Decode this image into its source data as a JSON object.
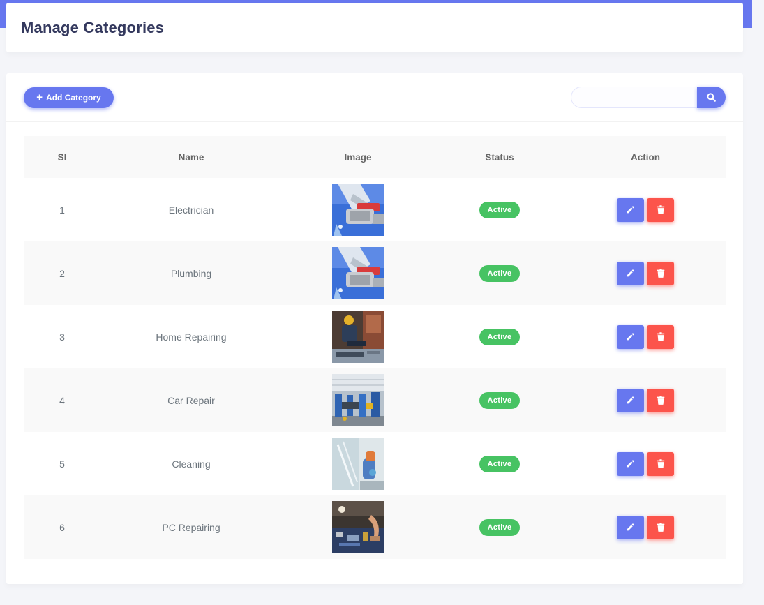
{
  "header": {
    "title": "Manage Categories"
  },
  "toolbar": {
    "add_label": "Add Category",
    "search_placeholder": ""
  },
  "table": {
    "columns": [
      "Sl",
      "Name",
      "Image",
      "Status",
      "Action"
    ],
    "rows": [
      {
        "sl": "1",
        "name": "Electrician",
        "image": "plumbing-wrench-photo",
        "status": "Active"
      },
      {
        "sl": "2",
        "name": "Plumbing",
        "image": "plumbing-wrench-photo",
        "status": "Active"
      },
      {
        "sl": "3",
        "name": "Home Repairing",
        "image": "worker-floor-photo",
        "status": "Active"
      },
      {
        "sl": "4",
        "name": "Car Repair",
        "image": "garage-photo",
        "status": "Active"
      },
      {
        "sl": "5",
        "name": "Cleaning",
        "image": "window-cleaning-photo",
        "status": "Active"
      },
      {
        "sl": "6",
        "name": "PC Repairing",
        "image": "circuit-board-photo",
        "status": "Active"
      }
    ]
  },
  "colors": {
    "primary": "#6777ef",
    "success": "#47c363",
    "danger": "#fc544b",
    "background": "#f4f5f9"
  },
  "icons": {
    "add": "plus-icon",
    "search": "search-icon",
    "edit": "pencil-icon",
    "delete": "trash-icon"
  }
}
